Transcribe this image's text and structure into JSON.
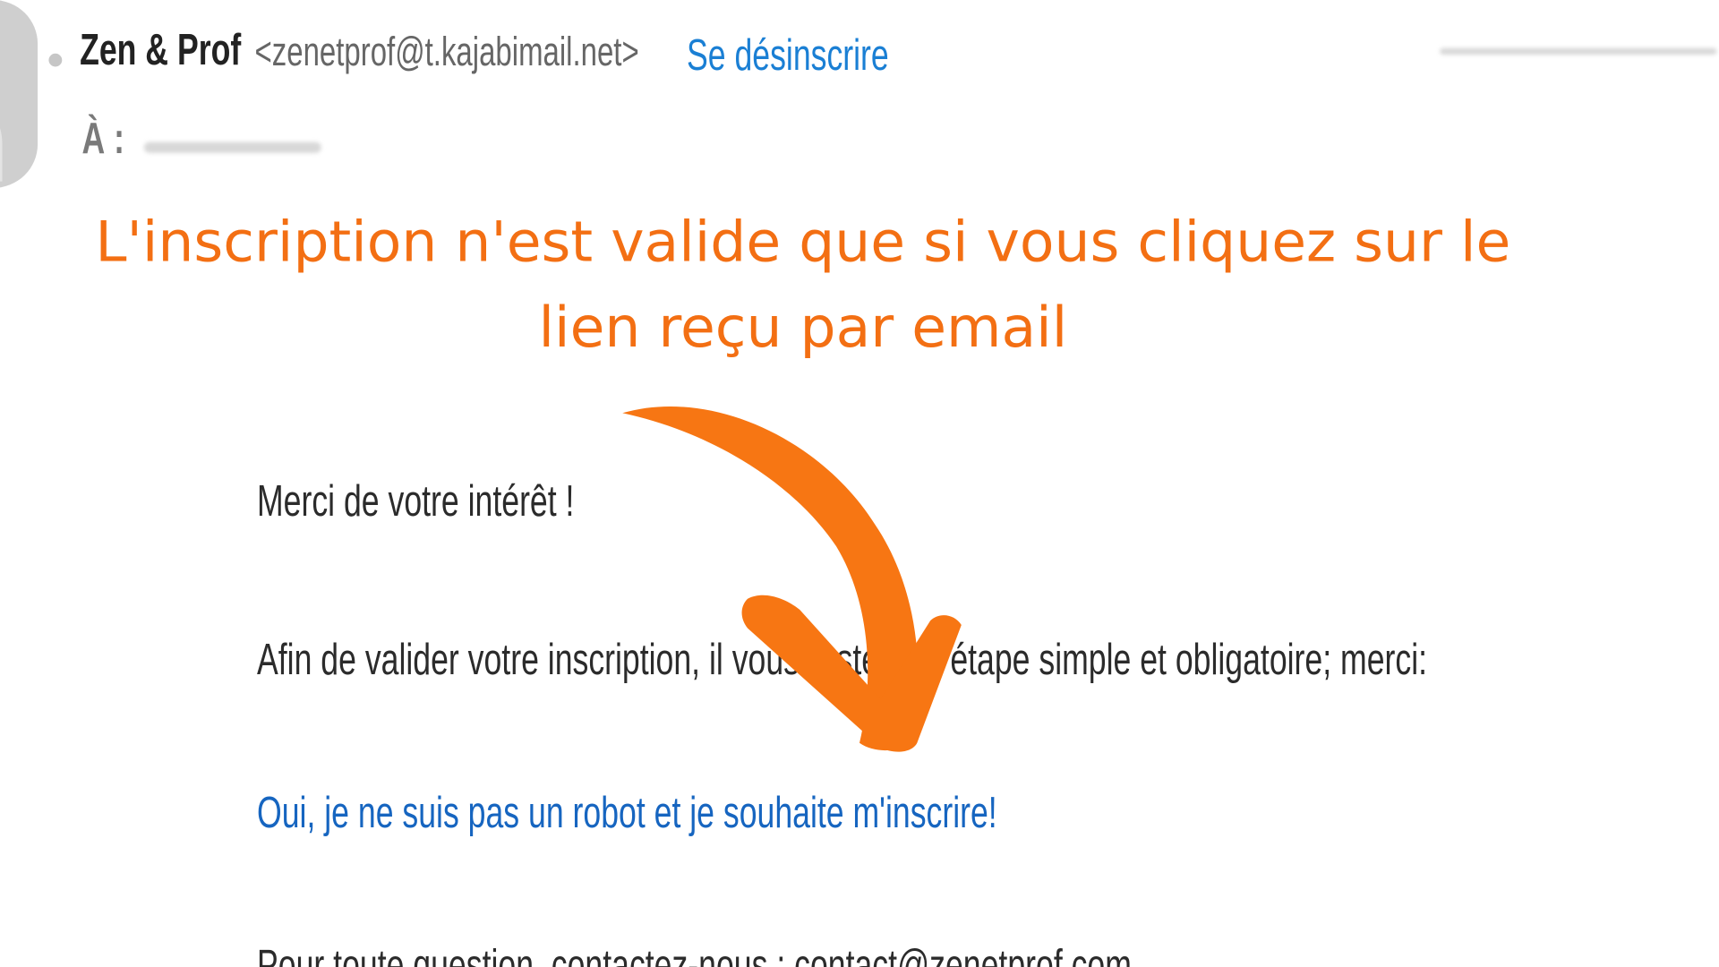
{
  "header": {
    "sender_name": "Zen & Prof",
    "sender_email": "<zenetprof@t.kajabimail.net>",
    "unsubscribe_label": "Se désinscrire",
    "to_label": "À :"
  },
  "annotation": {
    "text": "L'inscription n'est valide que si vous cliquez sur le lien reçu par email",
    "color": "#f36f13"
  },
  "email_body": {
    "greeting": "Merci de votre intérêt !",
    "instruction": "Afin de valider votre inscription, il vous reste une étape simple et obligatoire; merci:",
    "confirm_link": "Oui, je ne suis pas un robot et je souhaite m'inscrire!",
    "contact_line": "Pour toute question, contactez-nous : contact@zenetprof.com"
  },
  "colors": {
    "link": "#1a7fd4",
    "annotation": "#f36f13"
  },
  "icons": {
    "arrow": "curved-arrow-down-icon",
    "avatar": "user-avatar-icon"
  }
}
